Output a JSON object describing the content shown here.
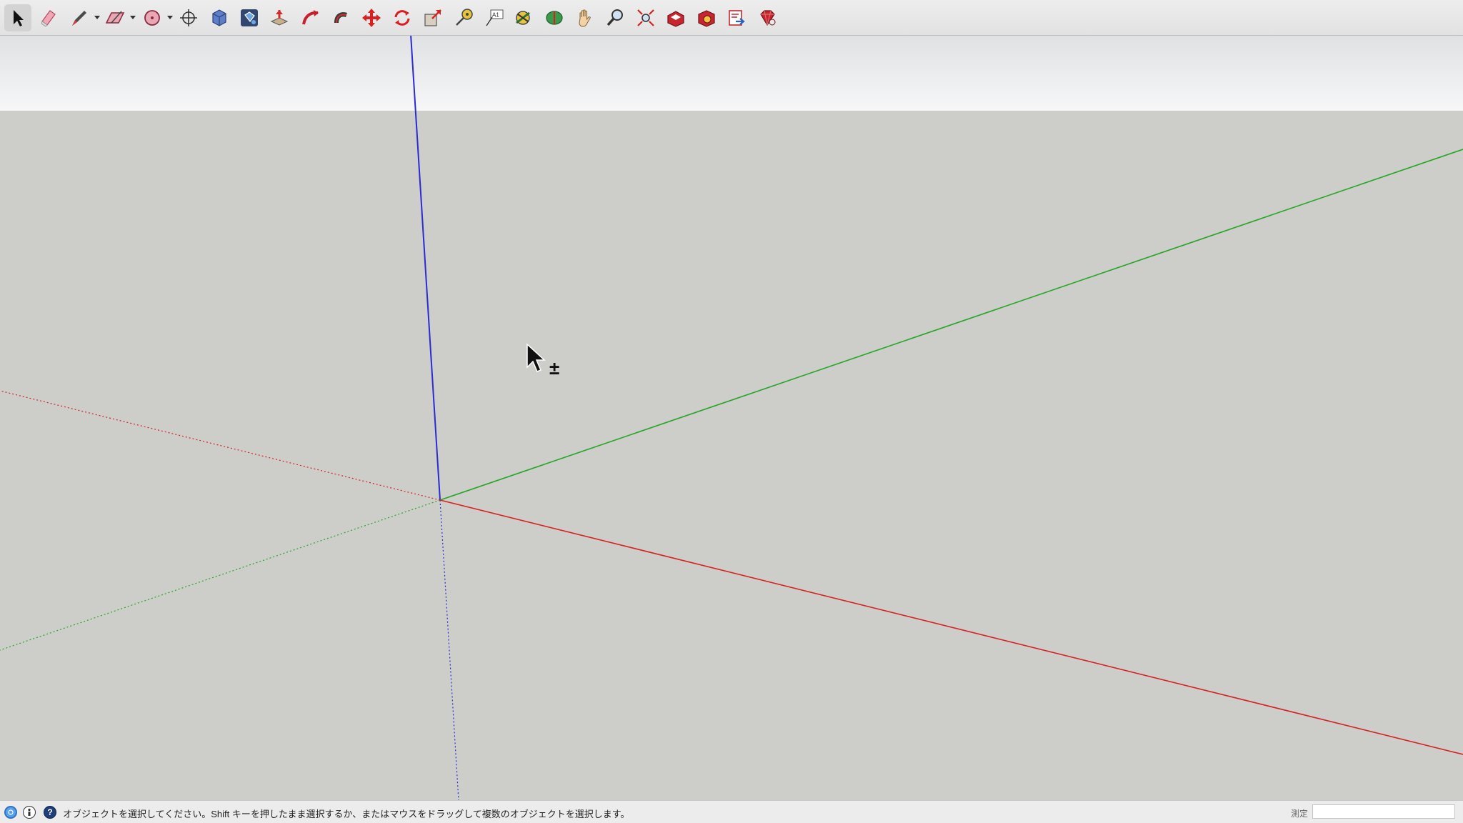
{
  "toolbar": {
    "tools": [
      {
        "name": "select-tool-icon",
        "active": true
      },
      {
        "name": "eraser-tool-icon"
      },
      {
        "name": "line-tool-icon",
        "dropdown": true
      },
      {
        "name": "rectangle-tool-icon",
        "dropdown": true
      },
      {
        "name": "circle-tool-icon",
        "dropdown": true
      },
      {
        "name": "orbit-crosshair-icon"
      },
      {
        "name": "make-component-icon"
      },
      {
        "name": "paint-bucket-icon"
      },
      {
        "name": "push-pull-tool-icon"
      },
      {
        "name": "follow-me-tool-icon"
      },
      {
        "name": "offset-tool-icon"
      },
      {
        "name": "move-tool-icon"
      },
      {
        "name": "rotate-tool-icon"
      },
      {
        "name": "scale-tool-icon"
      },
      {
        "name": "tape-measure-icon"
      },
      {
        "name": "text-tool-icon"
      },
      {
        "name": "axes-tool-icon"
      },
      {
        "name": "orbit-tool-icon"
      },
      {
        "name": "pan-tool-icon"
      },
      {
        "name": "zoom-tool-icon"
      },
      {
        "name": "zoom-extents-icon"
      },
      {
        "name": "warehouse-icon"
      },
      {
        "name": "extension-warehouse-icon"
      },
      {
        "name": "send-to-layout-icon"
      },
      {
        "name": "ruby-console-icon"
      }
    ],
    "text_tool_label": "A1"
  },
  "status": {
    "hint": "オブジェクトを選択してください。Shift キーを押したまま選択するか、またはマウスをドラッグして複数のオブジェクトを選択します。",
    "measure_label": "測定",
    "measure_value": "",
    "icons": [
      "geo-location-icon",
      "credits-icon",
      "instructor-icon"
    ]
  },
  "cursor": {
    "modifier": "±"
  },
  "colors": {
    "sky_top": "#dfe1e3",
    "sky_bottom": "#f7f7f8",
    "ground": "#cdcdc9",
    "red_axis": "#d52222",
    "green_axis": "#26a626",
    "blue_axis": "#2b2bd3"
  }
}
